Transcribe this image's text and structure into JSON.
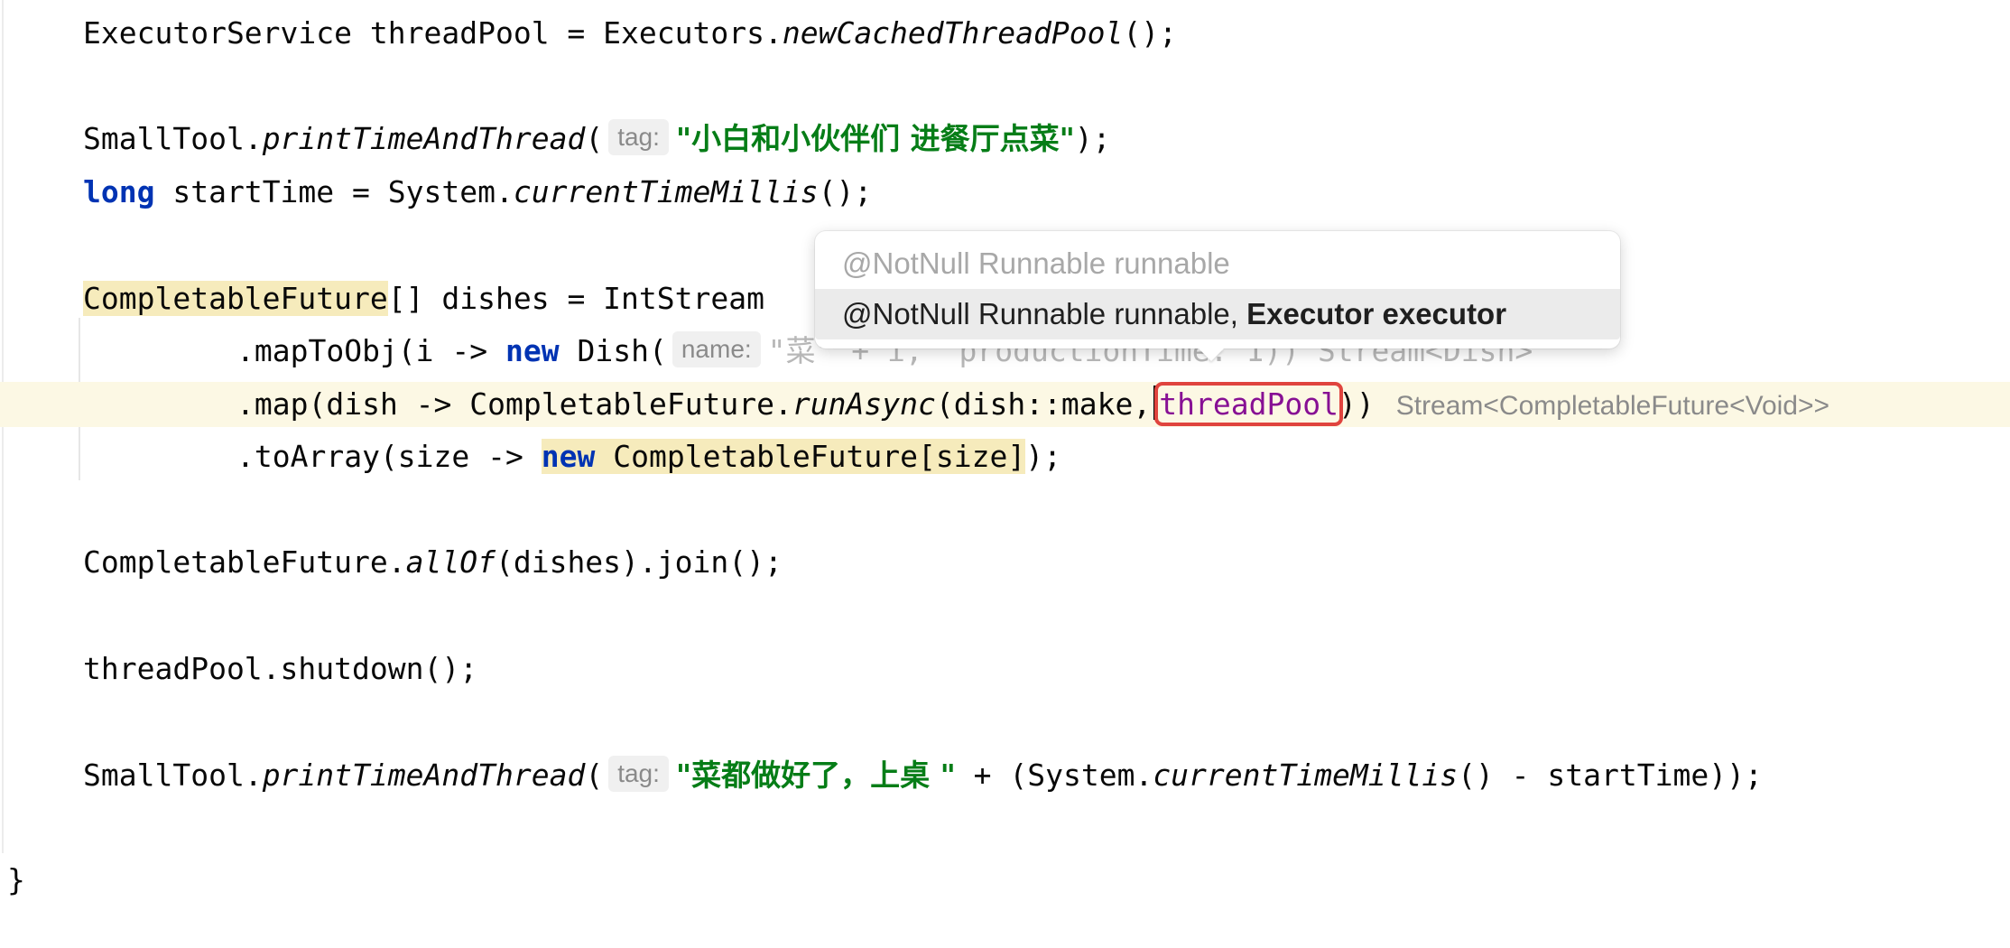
{
  "editor": {
    "lines": {
      "l1": {
        "a": "ExecutorService threadPool = Executors.",
        "b": "newCachedThreadPool",
        "c": "();"
      },
      "l2": {
        "a": "SmallTool.",
        "b": "printTimeAndThread",
        "c": "(",
        "hint": "tag:",
        "str": "\"小白和小伙伴们 进餐厅点菜\"",
        "d": ");"
      },
      "l3": {
        "kw": "long",
        "a": " startTime = System.",
        "b": "currentTimeMillis",
        "c": "();"
      },
      "l4": {
        "hl": "CompletableFuture",
        "a": "[] dishes = IntStream"
      },
      "l5": {
        "a": ".mapToObj(i -> ",
        "kw": "new",
        "b": " Dish(",
        "hint": "name:",
        "faded": "\"菜\" + i,  productionTime: 1)) Stream<Dish>"
      },
      "l6": {
        "a": ".map(dish -> CompletableFuture.",
        "b": "runAsync",
        "c": "(dish::make,",
        "boxed": "threadPool",
        "d": "))",
        "type_hint": "Stream<CompletableFuture<Void>>"
      },
      "l7": {
        "a": ".toArray(size -> ",
        "kw": "new",
        "hl": " CompletableFuture[size]",
        "c": ");"
      },
      "l8": {
        "a": "CompletableFuture.",
        "b": "allOf",
        "c": "(dishes).join();"
      },
      "l9": {
        "a": "threadPool.shutdown();"
      },
      "l10": {
        "a": "SmallTool.",
        "b": "printTimeAndThread",
        "c": "(",
        "hint": "tag:",
        "str": "\"菜都做好了，上桌 \"",
        "d": " + (System.",
        "e": "currentTimeMillis",
        "f": "() - startTime));"
      },
      "l11": {
        "a": "}"
      }
    }
  },
  "popup": {
    "option1": "@NotNull Runnable runnable",
    "option2_prefix": "@NotNull Runnable runnable, ",
    "option2_bold": "Executor executor"
  },
  "colors": {
    "keyword": "#0033b3",
    "string": "#067d17",
    "highlight": "#f6ebbc",
    "current_line": "#fcf8e4",
    "box": "#e0443e"
  }
}
